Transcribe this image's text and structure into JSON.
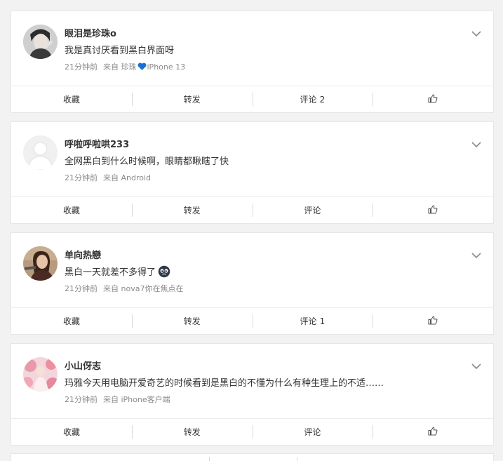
{
  "comments": [
    {
      "username": "眼泪是珍珠o",
      "avatar": "avatar-photo-man",
      "text": "我是真讨厌看到黑白界面呀",
      "time": "21分钟前",
      "source_prefix": "来自 珍珠",
      "source_icon": "blue-heart-icon",
      "source_suffix": "iPhone 13",
      "actions": {
        "favorite": "收藏",
        "repost": "转发",
        "comment": "评论",
        "comment_count": "2",
        "like_icon": "thumbs-up-icon"
      }
    },
    {
      "username": "呼啦呼啦哄233",
      "avatar": "avatar-default-placeholder",
      "text": "全网黑白到什么时候啊，眼睛都瞅瞎了快",
      "time": "21分钟前",
      "source_prefix": "来自 Android",
      "actions": {
        "favorite": "收藏",
        "repost": "转发",
        "comment": "评论",
        "comment_count": "",
        "like_icon": "thumbs-up-icon"
      }
    },
    {
      "username": "单向热戀",
      "avatar": "avatar-photo-woman",
      "text": "黑白一天就差不多得了",
      "text_emoji": "crying-emoji-icon",
      "time": "21分钟前",
      "source_prefix": "来自 nova7你在焦点在",
      "actions": {
        "favorite": "收藏",
        "repost": "转发",
        "comment": "评论",
        "comment_count": "1",
        "like_icon": "thumbs-up-icon"
      }
    },
    {
      "username": "小山伢志",
      "avatar": "avatar-photo-pink-flowers",
      "text": "玛雅今天用电脑开爱奇艺的时候看到是黑白的不懂为什么有种生理上的不适……",
      "time": "21分钟前",
      "source_prefix": "来自 iPhone客户端",
      "actions": {
        "favorite": "收藏",
        "repost": "转发",
        "comment": "评论",
        "comment_count": "",
        "like_icon": "thumbs-up-icon"
      }
    }
  ],
  "colors": {
    "background": "#f2f2f2",
    "card": "#ffffff",
    "text": "#333333",
    "meta": "#8a8a8a",
    "heart": "#1a6fd4"
  }
}
